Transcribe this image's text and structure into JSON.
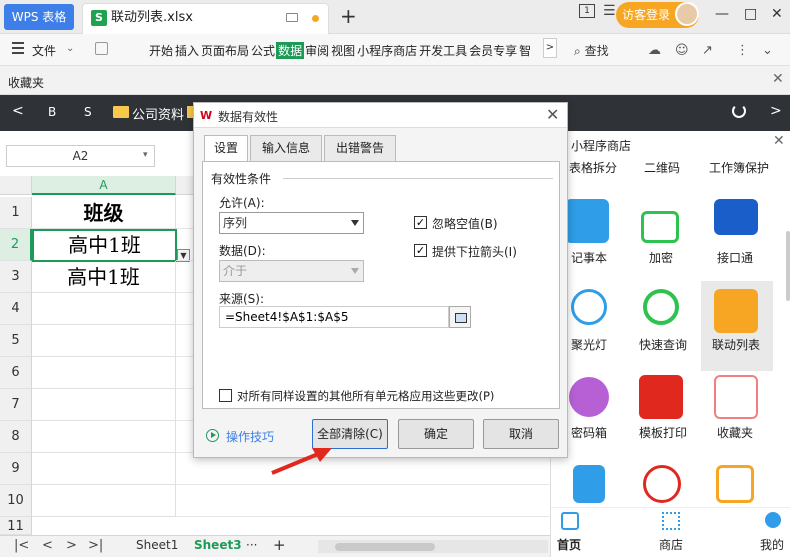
{
  "titlebar": {
    "app_tab": "WPS 表格",
    "file_icon": "S",
    "file_name": "联动列表.xlsx",
    "plus": "+",
    "badge": "1",
    "visitor": "访客登录",
    "menu_glyph": "☰",
    "minimize": "—",
    "maximize": "□",
    "close": "✕"
  },
  "menubar": {
    "file": "文件",
    "items": [
      "开始",
      "插入",
      "页面布局",
      "公式",
      "数据",
      "审阅",
      "视图",
      "小程序商店",
      "开发工具",
      "会员专享",
      "智"
    ],
    "active_index": 4,
    "more": ">",
    "search": "查找"
  },
  "favbar": {
    "label": "收藏夹",
    "close": "✕"
  },
  "darkbar": {
    "back": "<",
    "b1": "B",
    "b2": "S",
    "folder": "公司资料",
    "forward": ">"
  },
  "sheet": {
    "namebox": "A2",
    "col_a": "A",
    "rows": [
      "1",
      "2",
      "3",
      "4",
      "5",
      "6",
      "7",
      "8",
      "9",
      "10",
      "11"
    ],
    "a1": "班级",
    "a2": "高中1班",
    "a3": "高中1班"
  },
  "sheetbar": {
    "tabs": [
      "Sheet1",
      "Sheet3"
    ],
    "more": "···",
    "add": "+",
    "first": "|<",
    "prev": "<",
    "next": ">",
    "last": ">|"
  },
  "panel": {
    "title": "小程序商店",
    "close": "✕",
    "row0": [
      "表格拆分",
      "二维码",
      "工作簿保护"
    ],
    "row1": [
      "记事本",
      "加密",
      "接口通"
    ],
    "row2": [
      "聚光灯",
      "快速查询",
      "联动列表"
    ],
    "row3": [
      "密码箱",
      "模板打印",
      "收藏夹"
    ],
    "bottom": [
      "首页",
      "商店",
      "我的"
    ]
  },
  "dialog": {
    "title": "数据有效性",
    "logo": "W",
    "close": "✕",
    "tabs": [
      "设置",
      "输入信息",
      "出错警告"
    ],
    "section": "有效性条件",
    "allow_label": "允许(A):",
    "allow_value": "序列",
    "data_label": "数据(D):",
    "data_value": "介于",
    "ignore_blank": "忽略空值(B)",
    "ignore_blank_checked": "✓",
    "dropdown": "提供下拉箭头(I)",
    "dropdown_checked": "✓",
    "source_label": "来源(S):",
    "source_value": "=Sheet4!$A$1:$A$5",
    "apply_all": "对所有同样设置的其他所有单元格应用这些更改(P)",
    "tips": "操作技巧",
    "clear": "全部清除(C)",
    "ok": "确定",
    "cancel": "取消"
  },
  "colors": {
    "green": "#1e9a58",
    "blue": "#3d7ee8",
    "orange": "#f6a623",
    "red": "#e0281f"
  }
}
